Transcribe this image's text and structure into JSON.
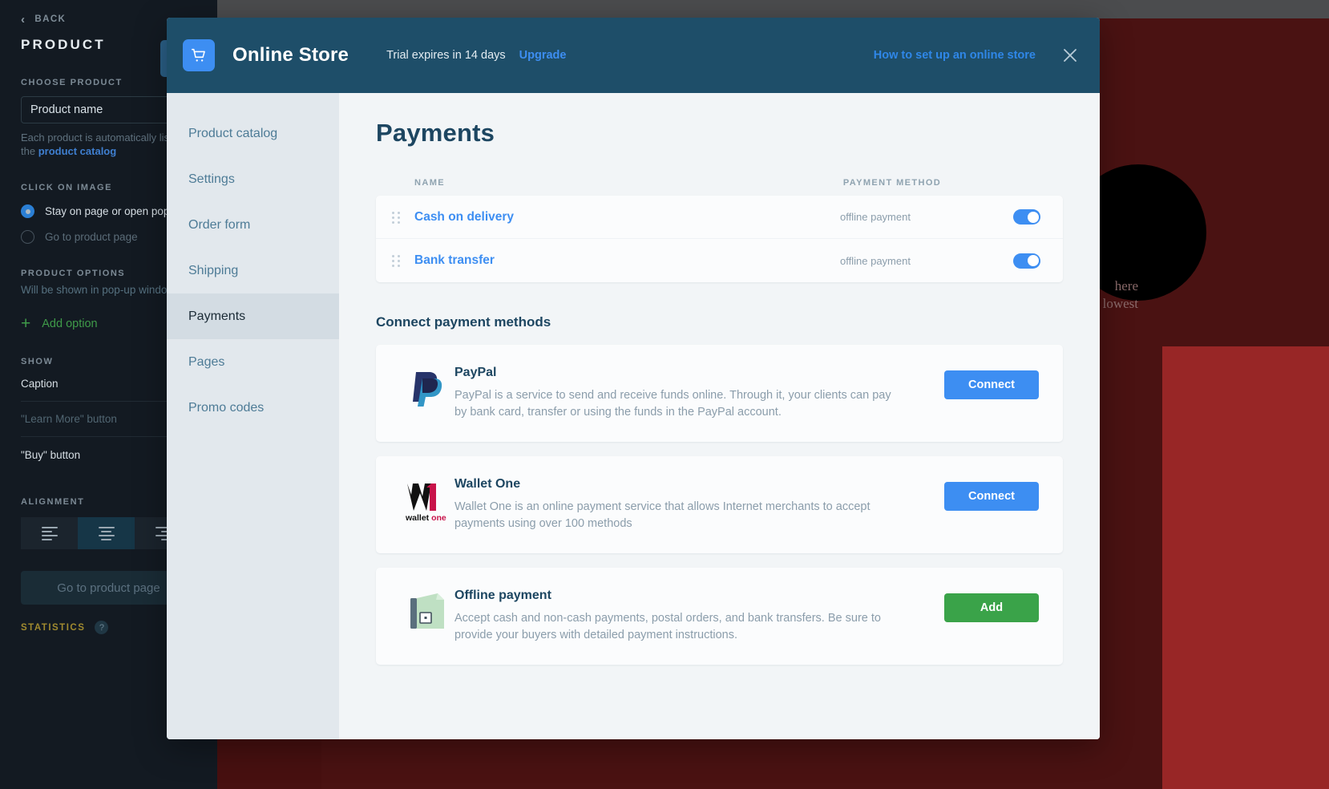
{
  "editor": {
    "back_label": "BACK",
    "panel_title": "PRODUCT",
    "choose_product_label": "CHOOSE PRODUCT",
    "product_name_value": "Product name",
    "hint_text": "Each product is automatically listed in",
    "hint_link": "product catalog",
    "hint_prefix": "the ",
    "click_on_image_label": "CLICK ON IMAGE",
    "radio_stay": "Stay on page or open pop-up",
    "radio_goto": "Go to product page",
    "product_options_label": "PRODUCT OPTIONS",
    "product_options_sub": "Will be shown in pop-up window",
    "add_option": "Add option",
    "show_label": "SHOW",
    "show_rows": [
      "Caption",
      "\"Learn More\" button",
      "\"Buy\" button"
    ],
    "alignment_label": "ALIGNMENT",
    "go_to_product_page": "Go to product page",
    "statistics_label": "STATISTICS",
    "statistics_help": "?"
  },
  "canvas": {
    "text_line_1": "here",
    "text_line_2": "lowest"
  },
  "modal": {
    "header": {
      "title": "Online Store",
      "trial": "Trial expires in 14 days",
      "upgrade": "Upgrade",
      "help_link": "How to set up an online store"
    },
    "nav": [
      {
        "label": "Product catalog",
        "active": false
      },
      {
        "label": "Settings",
        "active": false
      },
      {
        "label": "Order form",
        "active": false
      },
      {
        "label": "Shipping",
        "active": false
      },
      {
        "label": "Payments",
        "active": true
      },
      {
        "label": "Pages",
        "active": false
      },
      {
        "label": "Promo codes",
        "active": false
      }
    ],
    "page_title": "Payments",
    "table": {
      "columns": [
        "NAME",
        "PAYMENT METHOD"
      ],
      "rows": [
        {
          "name": "Cash on delivery",
          "method": "offline payment",
          "enabled": true
        },
        {
          "name": "Bank transfer",
          "method": "offline payment",
          "enabled": true
        }
      ]
    },
    "connect_section_title": "Connect payment methods",
    "methods": [
      {
        "name": "PayPal",
        "description": "PayPal is a service to send and receive funds online. Through it, your clients can pay by bank card, transfer or using the funds in the PayPal account.",
        "action": "Connect",
        "action_color": "#3d8ef2"
      },
      {
        "name": "Wallet One",
        "description": "Wallet One is an online payment service that allows Internet merchants to accept payments using over 100 methods",
        "action": "Connect",
        "action_color": "#3d8ef2"
      },
      {
        "name": "Offline payment",
        "description": "Accept cash and non-cash payments, postal orders, and bank transfers. Be sure to provide your buyers with detailed payment instructions.",
        "action": "Add",
        "action_color": "#3aa349"
      }
    ]
  },
  "colors": {
    "modal_header": "#1e4e69",
    "accent_blue": "#3d8ef2",
    "accent_green": "#3aa349",
    "sidebar_bg": "#131a22"
  }
}
